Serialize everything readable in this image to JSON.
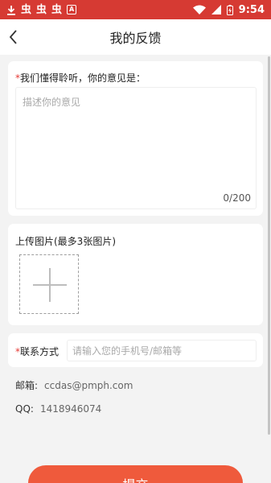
{
  "status_bar": {
    "time": "9:54",
    "left_icons": [
      "download-icon",
      "bug-icon",
      "bug-icon",
      "bug-icon",
      "a-icon"
    ],
    "right_icons": [
      "wifi-icon",
      "signal-icon",
      "battery-icon"
    ],
    "bug_glyph": "虫",
    "color": "#d63a33"
  },
  "header": {
    "title": "我的反馈"
  },
  "opinion": {
    "required_mark": "*",
    "label": "我们懂得聆听，你的意见是：",
    "placeholder": "描述你的意见",
    "count": "0/200"
  },
  "upload": {
    "label": "上传图片(最多3张图片)"
  },
  "contact": {
    "required_mark": "*",
    "label": "联系方式",
    "placeholder": "请输入您的手机号/邮箱等",
    "value": ""
  },
  "info": {
    "email_label": "邮箱:",
    "email_value": "ccdas@pmph.com",
    "qq_label": "QQ:",
    "qq_value": "1418946074"
  },
  "submit": {
    "label": "提交",
    "color": "#ef5a3c"
  }
}
